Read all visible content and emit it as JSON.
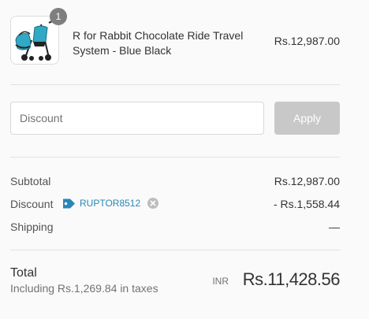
{
  "order_summary": {
    "items": [
      {
        "quantity": "1",
        "name": "R for Rabbit Chocolate Ride Travel System - Blue Black",
        "price": "Rs.12,987.00",
        "image": "stroller-travel-system-icon"
      }
    ],
    "discount": {
      "placeholder": "Discount",
      "value": "",
      "apply_label": "Apply"
    },
    "subtotal": {
      "label": "Subtotal",
      "value": "Rs.12,987.00"
    },
    "discount_row": {
      "label": "Discount",
      "code": "RUPTOR8512",
      "value": "- Rs.1,558.44"
    },
    "shipping": {
      "label": "Shipping",
      "value": "—"
    },
    "total": {
      "label": "Total",
      "tax_note": "Including Rs.1,269.84 in taxes",
      "currency": "INR",
      "amount": "Rs.11,428.56"
    }
  },
  "colors": {
    "accent": "#2a86b6",
    "stroller_fabric": "#31a9c4",
    "apply_disabled": "#c8c8c8",
    "badge": "#7f7f7f"
  }
}
